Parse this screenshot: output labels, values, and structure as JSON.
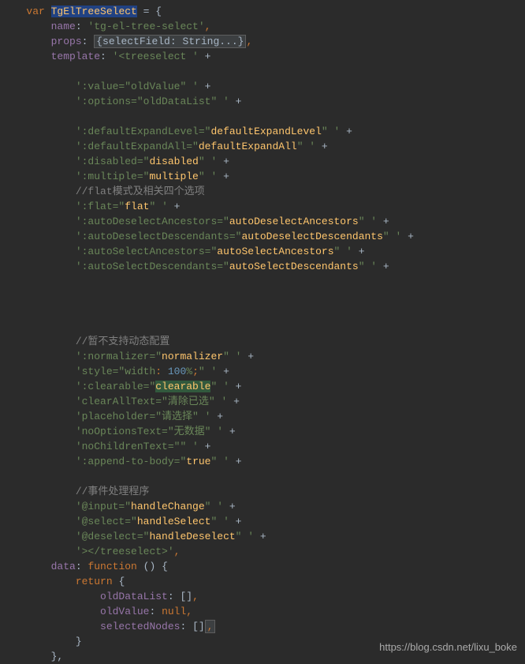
{
  "code": {
    "var_kw": "var",
    "class_name": "TgElTreeSelect",
    "equals": " = {",
    "name_key": "name",
    "name_val": "'tg-el-tree-select'",
    "props_key": "props",
    "props_val": "{selectField: String...}",
    "template_key": "template",
    "template_start": "'<treeselect '",
    "plus": " +",
    "lines": {
      "l_value": "':value=\"oldValue\" '",
      "l_options": "':options=\"oldDataList\" '",
      "l_defLevel_a": "':defaultExpandLevel=\"",
      "l_defLevel_b": "defaultExpandLevel",
      "l_defLevel_c": "\" '",
      "l_defAll_a": "':defaultExpandAll=\"",
      "l_defAll_b": "defaultExpandAll",
      "l_defAll_c": "\" '",
      "l_disabled_a": "':disabled=\"",
      "l_disabled_b": "disabled",
      "l_disabled_c": "\" '",
      "l_multiple_a": "':multiple=\"",
      "l_multiple_b": "multiple",
      "l_multiple_c": "\" '",
      "c_flat": "//flat模式及相关四个选项",
      "l_flat_a": "':flat=\"",
      "l_flat_b": "flat",
      "l_flat_c": "\" '",
      "l_adsa_a": "':autoDeselectAncestors=\"",
      "l_adsa_b": "autoDeselectAncestors",
      "l_adsa_c": "\" '",
      "l_adsd_a": "':autoDeselectDescendants=\"",
      "l_adsd_b": "autoDeselectDescendants",
      "l_adsd_c": "\" '",
      "l_asa_a": "':autoSelectAncestors=\"",
      "l_asa_b": "autoSelectAncestors",
      "l_asa_c": "\" '",
      "l_asd_a": "':autoSelectDescendants=\"",
      "l_asd_b": "autoSelectDescendants",
      "l_asd_c": "\" '",
      "c_dynamic": "//暂不支持动态配置",
      "l_norm_a": "':normalizer=\"",
      "l_norm_b": "normalizer",
      "l_norm_c": "\" '",
      "l_style_a": "'style=\"width",
      "l_style_colon": ": ",
      "l_style_num": "100",
      "l_style_pct": "%",
      "l_style_semi": ";",
      "l_style_c": "\" '",
      "l_clear_a": "':clearable=\"",
      "l_clear_b": "clearable",
      "l_clear_c": "\" '",
      "l_clearAll": "'clearAllText=\"清除已选\" '",
      "l_placeholder": "'placeholder=\"请选择\" '",
      "l_noOpt": "'noOptionsText=\"无数据\" '",
      "l_noChild": "'noChildrenText=\"\" '",
      "l_append_a": "':append-to-body=\"",
      "l_append_b": "true",
      "l_append_c": "\" '",
      "c_event": "//事件处理程序",
      "l_input_a": "'@input=\"",
      "l_input_b": "handleChange",
      "l_input_c": "\" '",
      "l_select_a": "'@select=\"",
      "l_select_b": "handleSelect",
      "l_select_c": "\" '",
      "l_deselect_a": "'@deselect=\"",
      "l_deselect_b": "handleDeselect",
      "l_deselect_c": "\" '",
      "l_close": "'></treeselect>'"
    },
    "data_key": "data",
    "function_kw": "function",
    "return_kw": "return",
    "oldDataList": "oldDataList",
    "oldValue": "oldValue",
    "null_kw": "null",
    "selectedNodes": "selectedNodes",
    "arr": "[]",
    "comma": ",",
    "open_brace": "{",
    "close_brace": "}",
    "close_brace_comma": "},",
    "paren": "()"
  },
  "watermark": "https://blog.csdn.net/lixu_boke"
}
